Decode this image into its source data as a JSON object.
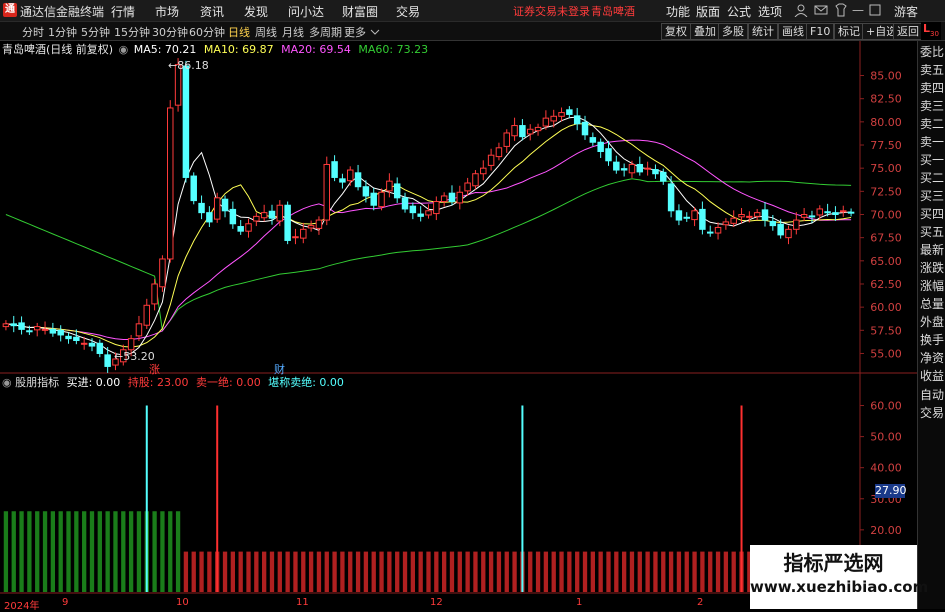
{
  "titlebar": {
    "app_title": "通达信金融终端",
    "menus": [
      "行情",
      "市场",
      "资讯",
      "发现",
      "问小达",
      "财富圈",
      "交易"
    ],
    "login_notice": "证券交易未登录",
    "stock_name": "青岛啤酒",
    "right_menus": [
      "功能",
      "版面",
      "公式",
      "选项"
    ],
    "guest": "游客"
  },
  "toolbar": {
    "periods": [
      "分时",
      "1分钟",
      "5分钟",
      "15分钟",
      "30分钟",
      "60分钟",
      "日线",
      "周线",
      "月线",
      "多周期",
      "更多"
    ],
    "active_period": "日线",
    "buttons": [
      "复权",
      "叠加",
      "多股",
      "统计",
      "画线",
      "F10",
      "标记",
      "+自选",
      "返回"
    ]
  },
  "main_legend": {
    "title": "青岛啤酒(日线 前复权)",
    "ma5": "MA5: 70.21",
    "ma10": "MA10: 69.87",
    "ma20": "MA20: 69.54",
    "ma60": "MA60: 73.23"
  },
  "sub_legend": {
    "name": "股朋指标",
    "buy": "买进: 0.00",
    "hold": "持股: 23.00",
    "sell_all": "卖一绝: 0.00",
    "perfect": "堪称卖绝: 0.00"
  },
  "right_panel": [
    "委比",
    "卖五",
    "卖四",
    "卖三",
    "卖二",
    "卖一",
    "买一",
    "买二",
    "买三",
    "买四",
    "买五",
    "最新",
    "涨跌",
    "涨幅",
    "总量",
    "外盘",
    "换手",
    "净资",
    "收益"
  ],
  "right_panel2": [
    "自动",
    "交易"
  ],
  "markers": {
    "high_label": "86.18",
    "low_label": "53.20",
    "zhang": "涨",
    "cai": "财",
    "sub_current": "27.90",
    "l_badge": "L",
    "l_sub": "30"
  },
  "x_labels": [
    "2024年",
    "9",
    "10",
    "11",
    "12",
    "1",
    "2"
  ],
  "watermark": {
    "title": "指标严选网",
    "url": "www.xuezhibiao.com"
  },
  "colors": {
    "up": "#ff3b3b",
    "down": "#54ffff",
    "ma5": "#ffffff",
    "ma10": "#ffff55",
    "ma20": "#ff55ff",
    "ma60": "#33cc33",
    "green_bar": "#1a7d1a",
    "red_bar": "#b02020"
  },
  "chart_data": {
    "type": "candlestick",
    "price_axis": [
      55.0,
      57.5,
      60.0,
      62.5,
      65.0,
      67.5,
      70.0,
      72.5,
      75.0,
      77.5,
      80.0,
      82.5,
      85.0
    ],
    "price_range": [
      53.2,
      86.18
    ],
    "sub_axis": [
      20.0,
      30.0,
      40.0,
      50.0,
      60.0
    ],
    "sub_range": [
      0,
      65
    ],
    "closes": [
      58.2,
      58.0,
      57.6,
      57.4,
      57.9,
      57.6,
      57.2,
      57.0,
      56.6,
      56.4,
      56.1,
      55.8,
      55.0,
      53.6,
      54.4,
      55.4,
      56.6,
      58.2,
      60.2,
      62.5,
      65.2,
      81.5,
      86.18,
      74.0,
      71.5,
      70.2,
      69.2,
      71.8,
      70.4,
      69.0,
      68.2,
      69.0,
      69.8,
      70.2,
      69.6,
      71.0,
      67.2,
      67.6,
      68.4,
      68.8,
      69.4,
      75.4,
      74.0,
      73.5,
      74.8,
      73.0,
      72.0,
      71.0,
      72.4,
      73.6,
      71.8,
      70.6,
      70.2,
      69.8,
      70.4,
      71.4,
      72.0,
      71.4,
      72.4,
      73.4,
      74.4,
      75.0,
      76.4,
      77.2,
      78.8,
      79.6,
      78.4,
      79.2,
      79.4,
      80.4,
      80.6,
      81.0,
      80.8,
      79.8,
      78.6,
      77.8,
      76.8,
      75.8,
      74.8,
      74.8,
      75.4,
      74.6,
      75.0,
      74.4,
      73.6,
      70.4,
      69.4,
      69.6,
      70.4,
      68.4,
      68.0,
      68.6,
      69.2,
      69.6,
      70.0,
      69.8,
      70.2,
      69.4,
      68.8,
      67.8,
      68.4,
      69.4,
      70.0,
      69.8,
      70.6,
      70.2,
      70.0,
      70.4,
      70.2
    ],
    "sub_values": [
      26,
      26,
      26,
      26,
      26,
      26,
      26,
      26,
      26,
      26,
      26,
      26,
      26,
      26,
      26,
      26,
      26,
      26,
      26,
      26,
      26,
      26,
      26,
      13,
      13,
      13,
      13,
      13,
      13,
      13,
      13,
      13,
      13,
      13,
      13,
      13,
      13,
      13,
      13,
      13,
      13,
      13,
      13,
      13,
      13,
      13,
      13,
      13,
      13,
      13,
      13,
      13,
      13,
      13,
      13,
      13,
      13,
      13,
      13,
      13,
      13,
      13,
      13,
      13,
      13,
      13,
      13,
      13,
      13,
      13,
      13,
      13,
      13,
      13,
      13,
      13,
      13,
      13,
      13,
      13,
      13,
      13,
      13,
      13,
      13,
      13,
      13,
      13,
      13,
      13,
      13,
      13,
      13,
      13,
      13,
      13,
      13,
      13,
      13,
      13,
      13,
      13,
      13,
      13,
      13,
      13,
      13,
      13,
      13,
      13
    ],
    "signals": [
      {
        "idx": 18,
        "color": "cyan"
      },
      {
        "idx": 27,
        "color": "red"
      },
      {
        "idx": 66,
        "color": "cyan"
      },
      {
        "idx": 94,
        "color": "red"
      },
      {
        "idx": 117,
        "color": "cyan"
      },
      {
        "idx": 141,
        "color": "cyan"
      }
    ]
  }
}
